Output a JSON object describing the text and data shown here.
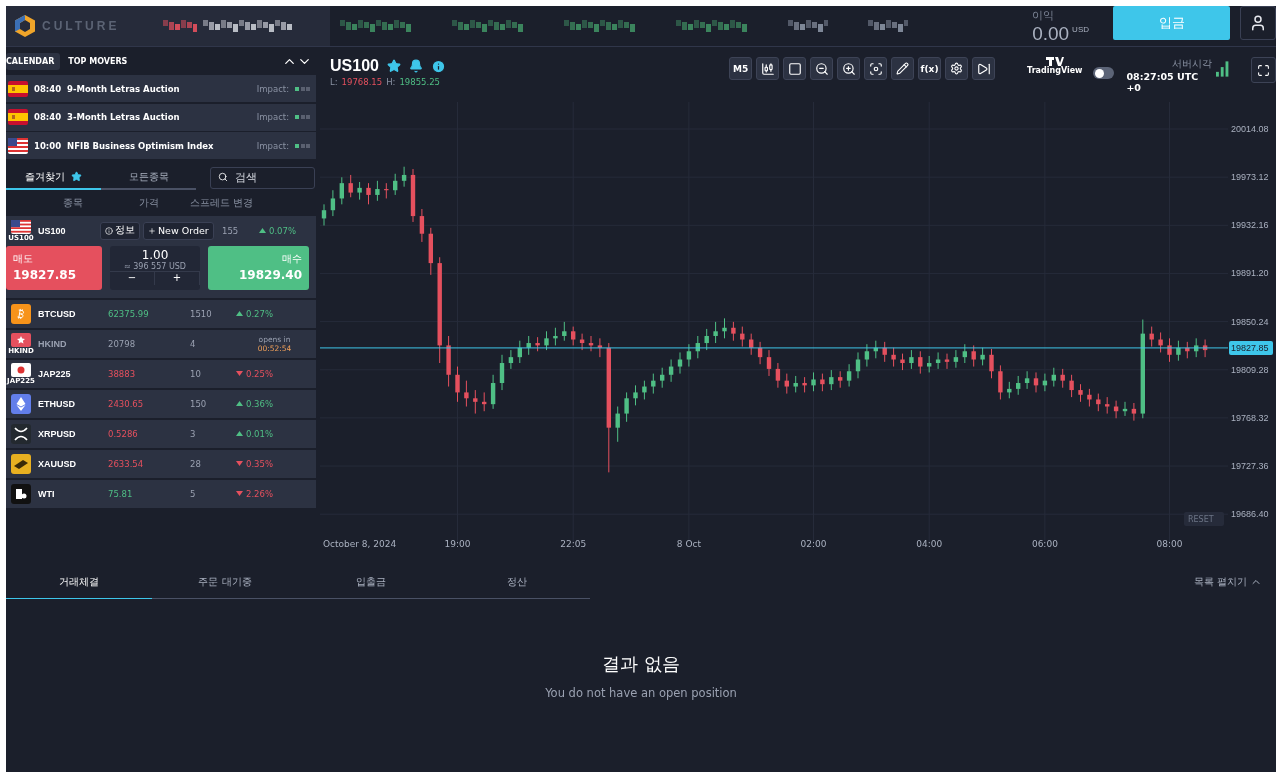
{
  "header": {
    "logo_text": "CULTURE",
    "profit_label": "이익",
    "profit_value": "0.00",
    "profit_currency": "USD",
    "deposit_button": "입금"
  },
  "calendar": {
    "tabs": [
      {
        "label": "CALENDAR",
        "selected": true
      },
      {
        "label": "TOP MOVERS",
        "selected": false
      }
    ],
    "events": [
      {
        "kind": "es",
        "time": "08:40",
        "title": "9-Month Letras Auction",
        "impact_label": "Impact:",
        "level": 0.33
      },
      {
        "kind": "es",
        "time": "08:40",
        "title": "3-Month Letras Auction",
        "impact_label": "Impact:",
        "level": 0.33
      },
      {
        "kind": "us",
        "time": "10:00",
        "title": "NFIB Business Optimism Index",
        "impact_label": "Impact:",
        "level": 0.33
      }
    ]
  },
  "watchlist": {
    "tabs": [
      {
        "label": "즐겨찾기",
        "selected": true,
        "starred": true
      },
      {
        "label": "모든종목",
        "selected": false,
        "starred": false
      }
    ],
    "search": {
      "placeholder": "검색"
    },
    "columns": [
      "종목",
      "가격",
      "스프레드",
      "변경"
    ],
    "expanded": {
      "kind": "us",
      "caption": "US100",
      "symbol": "US100",
      "info_button": "정보",
      "order_button": "New Order",
      "spread": "155",
      "change": "0.07%",
      "rising": true,
      "sell_label": "매도",
      "sell_price": "19827.85",
      "quantity": "1.00",
      "notional": "≈ 396 557 USD",
      "minus": "−",
      "plus": "+",
      "buy_label": "매수",
      "buy_price": "19829.40"
    },
    "rows": [
      {
        "kind": "btc",
        "symbol": "BTCUSD",
        "price": "62375.99",
        "price_up": true,
        "spread": "1510",
        "open": true,
        "change": "0.27%",
        "rising": true
      },
      {
        "kind": "hk",
        "caption": "HKIND",
        "symbol": "HKIND",
        "price": "20798",
        "spread": "4",
        "open": false,
        "opens_label": "opens in",
        "opens_time": "00:52:54"
      },
      {
        "kind": "jp",
        "caption": "JAP225",
        "symbol": "JAP225",
        "price": "38883",
        "price_up": false,
        "spread": "10",
        "open": true,
        "change": "0.25%",
        "rising": false
      },
      {
        "kind": "eth",
        "symbol": "ETHUSD",
        "price": "2430.65",
        "price_up": false,
        "spread": "150",
        "open": true,
        "change": "0.36%",
        "rising": true
      },
      {
        "kind": "xrp",
        "symbol": "XRPUSD",
        "price": "0.5286",
        "price_up": false,
        "spread": "3",
        "open": true,
        "change": "0.01%",
        "rising": true
      },
      {
        "kind": "gold",
        "symbol": "XAUUSD",
        "price": "2633.54",
        "price_up": false,
        "spread": "28",
        "open": true,
        "change": "0.35%",
        "rising": false
      },
      {
        "kind": "oil",
        "symbol": "WTI",
        "price": "75.81",
        "price_up": true,
        "spread": "5",
        "open": true,
        "change": "2.26%",
        "rising": false
      }
    ]
  },
  "chart": {
    "symbol": "US100",
    "low_label": "L:",
    "low": "19768.15",
    "high_label": "H:",
    "high": "19855.25",
    "interval": "M5",
    "function_label": "f(x)",
    "tradingview_label": "TradingView",
    "toggle_on": false,
    "server_time_label": "서버시각",
    "server_time": "08:27:05 UTC +0",
    "reset": "RESET",
    "chart_data": {
      "type": "candlestick",
      "categories": [
        null,
        null,
        null,
        null,
        "October 8, 2024",
        null,
        null,
        null,
        null,
        null,
        null,
        null,
        null,
        null,
        null,
        "19:00",
        null,
        null,
        null,
        null,
        null,
        null,
        null,
        null,
        null,
        null,
        null,
        null,
        "22:05",
        null,
        null,
        null,
        null,
        null,
        null,
        null,
        null,
        null,
        null,
        null,
        null,
        "8 Oct",
        null,
        null,
        null,
        null,
        null,
        null,
        null,
        null,
        null,
        null,
        null,
        null,
        null,
        "02:00",
        null,
        null,
        null,
        null,
        null,
        null,
        null,
        null,
        null,
        null,
        null,
        null,
        "04:00",
        null,
        null,
        null,
        null,
        null,
        null,
        null,
        null,
        null,
        null,
        null,
        null,
        "06:00",
        null,
        null,
        null,
        null,
        null,
        null,
        null,
        null,
        null,
        null,
        null,
        null,
        null,
        "08:00",
        null,
        null,
        null,
        null
      ],
      "ohlc": [
        [
          19938,
          19950,
          19932,
          19945
        ],
        [
          19945,
          19962,
          19940,
          19955
        ],
        [
          19955,
          19973,
          19950,
          19968
        ],
        [
          19968,
          19975,
          19956,
          19960
        ],
        [
          19960,
          19969,
          19954,
          19964
        ],
        [
          19964,
          19968,
          19950,
          19958
        ],
        [
          19958,
          19970,
          19953,
          19963
        ],
        [
          19963,
          19968,
          19955,
          19962
        ],
        [
          19962,
          19976,
          19958,
          19970
        ],
        [
          19970,
          19982,
          19965,
          19975
        ],
        [
          19975,
          19980,
          19935,
          19940
        ],
        [
          19940,
          19946,
          19918,
          19925
        ],
        [
          19925,
          19930,
          19890,
          19900
        ],
        [
          19900,
          19905,
          19815,
          19830
        ],
        [
          19830,
          19838,
          19795,
          19805
        ],
        [
          19805,
          19812,
          19782,
          19790
        ],
        [
          19790,
          19800,
          19778,
          19785
        ],
        [
          19785,
          19792,
          19772,
          19782
        ],
        [
          19782,
          19790,
          19774,
          19780
        ],
        [
          19780,
          19805,
          19776,
          19798
        ],
        [
          19798,
          19822,
          19792,
          19815
        ],
        [
          19815,
          19826,
          19810,
          19820
        ],
        [
          19820,
          19834,
          19815,
          19828
        ],
        [
          19828,
          19838,
          19822,
          19832
        ],
        [
          19832,
          19837,
          19825,
          19830
        ],
        [
          19830,
          19842,
          19826,
          19836
        ],
        [
          19836,
          19845,
          19830,
          19838
        ],
        [
          19838,
          19850,
          19834,
          19842
        ],
        [
          19842,
          19846,
          19830,
          19835
        ],
        [
          19835,
          19840,
          19826,
          19832
        ],
        [
          19832,
          19838,
          19825,
          19830
        ],
        [
          19830,
          19836,
          19820,
          19828
        ],
        [
          19828,
          19832,
          19722,
          19760
        ],
        [
          19760,
          19778,
          19748,
          19772
        ],
        [
          19772,
          19790,
          19765,
          19785
        ],
        [
          19785,
          19796,
          19779,
          19790
        ],
        [
          19790,
          19800,
          19784,
          19795
        ],
        [
          19795,
          19806,
          19789,
          19800
        ],
        [
          19800,
          19811,
          19794,
          19805
        ],
        [
          19805,
          19818,
          19799,
          19812
        ],
        [
          19812,
          19824,
          19806,
          19818
        ],
        [
          19818,
          19831,
          19812,
          19825
        ],
        [
          19825,
          19838,
          19819,
          19832
        ],
        [
          19832,
          19844,
          19826,
          19838
        ],
        [
          19838,
          19850,
          19832,
          19842
        ],
        [
          19842,
          19853,
          19836,
          19845
        ],
        [
          19845,
          19850,
          19834,
          19840
        ],
        [
          19840,
          19846,
          19829,
          19835
        ],
        [
          19835,
          19840,
          19822,
          19828
        ],
        [
          19828,
          19833,
          19814,
          19820
        ],
        [
          19820,
          19826,
          19804,
          19810
        ],
        [
          19810,
          19815,
          19794,
          19800
        ],
        [
          19800,
          19806,
          19789,
          19795
        ],
        [
          19795,
          19804,
          19790,
          19798
        ],
        [
          19798,
          19803,
          19790,
          19796
        ],
        [
          19796,
          19807,
          19791,
          19801
        ],
        [
          19801,
          19806,
          19791,
          19797
        ],
        [
          19797,
          19809,
          19792,
          19803
        ],
        [
          19803,
          19808,
          19794,
          19800
        ],
        [
          19800,
          19814,
          19795,
          19808
        ],
        [
          19808,
          19824,
          19802,
          19818
        ],
        [
          19818,
          19831,
          19812,
          19825
        ],
        [
          19825,
          19834,
          19819,
          19828
        ],
        [
          19828,
          19833,
          19816,
          19822
        ],
        [
          19822,
          19828,
          19812,
          19818
        ],
        [
          19818,
          19823,
          19809,
          19815
        ],
        [
          19815,
          19826,
          19810,
          19820
        ],
        [
          19820,
          19825,
          19806,
          19812
        ],
        [
          19812,
          19821,
          19807,
          19815
        ],
        [
          19815,
          19824,
          19810,
          19818
        ],
        [
          19818,
          19823,
          19810,
          19816
        ],
        [
          19816,
          19826,
          19811,
          19820
        ],
        [
          19820,
          19831,
          19815,
          19825
        ],
        [
          19825,
          19830,
          19812,
          19818
        ],
        [
          19818,
          19828,
          19813,
          19822
        ],
        [
          19822,
          19827,
          19802,
          19808
        ],
        [
          19808,
          19813,
          19784,
          19790
        ],
        [
          19790,
          19799,
          19785,
          19793
        ],
        [
          19793,
          19804,
          19788,
          19798
        ],
        [
          19798,
          19808,
          19793,
          19802
        ],
        [
          19802,
          19807,
          19790,
          19796
        ],
        [
          19796,
          19806,
          19791,
          19800
        ],
        [
          19800,
          19811,
          19795,
          19805
        ],
        [
          19805,
          19810,
          19794,
          19800
        ],
        [
          19800,
          19805,
          19786,
          19792
        ],
        [
          19792,
          19797,
          19782,
          19788
        ],
        [
          19788,
          19793,
          19778,
          19784
        ],
        [
          19784,
          19789,
          19774,
          19780
        ],
        [
          19780,
          19786,
          19772,
          19778
        ],
        [
          19778,
          19783,
          19768,
          19774
        ],
        [
          19774,
          19782,
          19770,
          19776
        ],
        [
          19776,
          19781,
          19766,
          19772
        ],
        [
          19772,
          19852,
          19768,
          19840
        ],
        [
          19840,
          19846,
          19829,
          19835
        ],
        [
          19835,
          19841,
          19824,
          19830
        ],
        [
          19830,
          19836,
          19816,
          19822
        ],
        [
          19822,
          19834,
          19817,
          19828
        ],
        [
          19828,
          19833,
          19819,
          19825
        ],
        [
          19825,
          19836,
          19820,
          19830
        ],
        [
          19830,
          19835,
          19820,
          19826
        ]
      ],
      "ylim": [
        19686.4,
        20014.08
      ],
      "grid": true,
      "ref_lines": [
        {
          "axis": "y",
          "value": 19827.85,
          "label": "19827.85",
          "color": "#3ec6ea"
        }
      ],
      "yticks": [
        {
          "value": 20014.08,
          "label": "20014.08"
        },
        {
          "value": 19973.12,
          "label": "19973.12"
        },
        {
          "value": 19932.16,
          "label": "19932.16"
        },
        {
          "value": 19891.2,
          "label": "19891.20"
        },
        {
          "value": 19850.24,
          "label": "19850.24"
        },
        {
          "value": 19809.28,
          "label": "19809.28"
        },
        {
          "value": 19768.32,
          "label": "19768.32"
        },
        {
          "value": 19727.36,
          "label": "19727.36"
        },
        {
          "value": 19686.4,
          "label": "19686.40"
        }
      ]
    }
  },
  "positions": {
    "tabs": [
      {
        "label": "거래체결",
        "selected": true
      },
      {
        "label": "주문 대기중",
        "selected": false
      },
      {
        "label": "입출금",
        "selected": false
      },
      {
        "label": "정산",
        "selected": false
      }
    ],
    "expand_label": "목록 펼치기",
    "empty_title": "결과 없음",
    "empty_message": "You do not have an open position"
  }
}
